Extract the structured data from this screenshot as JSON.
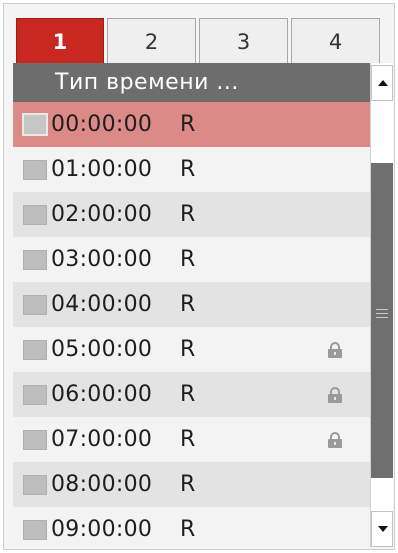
{
  "tabs": [
    {
      "label": "1",
      "active": true
    },
    {
      "label": "2",
      "active": false
    },
    {
      "label": "3",
      "active": false
    },
    {
      "label": "4",
      "active": false
    }
  ],
  "list": {
    "header": "Тип времени ...",
    "rows": [
      {
        "time": "00:00:00",
        "flag": "R",
        "locked": false,
        "selected": true
      },
      {
        "time": "01:00:00",
        "flag": "R",
        "locked": false,
        "selected": false
      },
      {
        "time": "02:00:00",
        "flag": "R",
        "locked": false,
        "selected": false
      },
      {
        "time": "03:00:00",
        "flag": "R",
        "locked": false,
        "selected": false
      },
      {
        "time": "04:00:00",
        "flag": "R",
        "locked": false,
        "selected": false
      },
      {
        "time": "05:00:00",
        "flag": "R",
        "locked": true,
        "selected": false
      },
      {
        "time": "06:00:00",
        "flag": "R",
        "locked": true,
        "selected": false
      },
      {
        "time": "07:00:00",
        "flag": "R",
        "locked": true,
        "selected": false
      },
      {
        "time": "08:00:00",
        "flag": "R",
        "locked": false,
        "selected": false
      },
      {
        "time": "09:00:00",
        "flag": "R",
        "locked": false,
        "selected": false
      }
    ]
  },
  "icons": {
    "lock": "lock-icon",
    "scroll_up": "arrow-up-icon",
    "scroll_down": "arrow-down-icon",
    "grip": "grip-icon"
  },
  "colors": {
    "active_tab": "#c8281f",
    "selected_row": "#dc8a88",
    "header_bg": "#6d6d6d",
    "scroll_thumb": "#6f6f6f"
  }
}
